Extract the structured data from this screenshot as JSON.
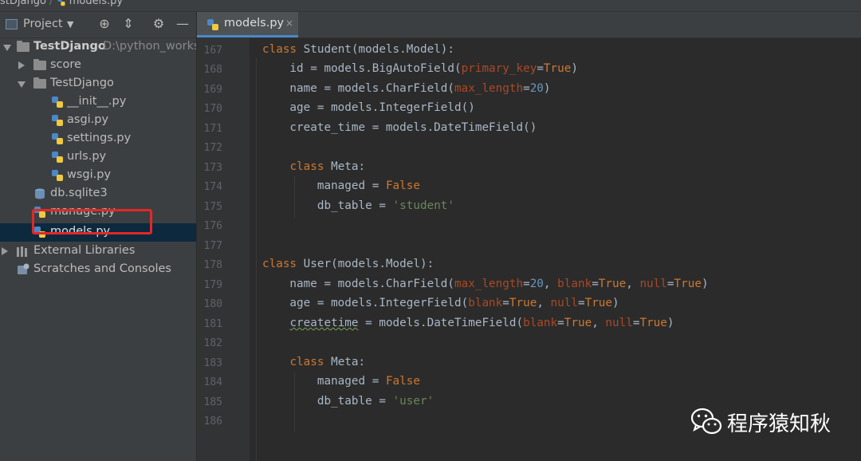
{
  "breadcrumb": {
    "project": "stDjango",
    "separator": "/",
    "file": "models.py"
  },
  "project_panel": {
    "title": "Project",
    "tree": [
      {
        "name": "TestDjango",
        "path": "D:\\python_worksp",
        "kind": "folder",
        "expanded": true
      },
      {
        "name": "score",
        "kind": "folder",
        "expanded": false
      },
      {
        "name": "TestDjango",
        "kind": "folder",
        "expanded": true
      },
      {
        "name": "__init__.py",
        "kind": "py"
      },
      {
        "name": "asgi.py",
        "kind": "py"
      },
      {
        "name": "settings.py",
        "kind": "py"
      },
      {
        "name": "urls.py",
        "kind": "py"
      },
      {
        "name": "wsgi.py",
        "kind": "py"
      },
      {
        "name": "db.sqlite3",
        "kind": "db"
      },
      {
        "name": "manage.py",
        "kind": "py"
      },
      {
        "name": "models.py",
        "kind": "py",
        "selected": true
      },
      {
        "name": "External Libraries",
        "kind": "lib"
      },
      {
        "name": "Scratches and Consoles",
        "kind": "scratch"
      }
    ]
  },
  "editor": {
    "tab": {
      "label": "models.py",
      "close": "×"
    },
    "line_numbers": [
      "167",
      "168",
      "169",
      "170",
      "171",
      "172",
      "173",
      "174",
      "175",
      "176",
      "177",
      "178",
      "179",
      "180",
      "181",
      "182",
      "183",
      "184",
      "185",
      "186"
    ]
  },
  "watermark": {
    "text": "程序猿知秋"
  },
  "colors": {
    "keyword": "#cc7832",
    "string": "#6a8759",
    "number": "#6897bb",
    "param": "#aa4926",
    "text": "#a9b7c6",
    "selection": "#0d293e",
    "highlight": "#e32727"
  }
}
